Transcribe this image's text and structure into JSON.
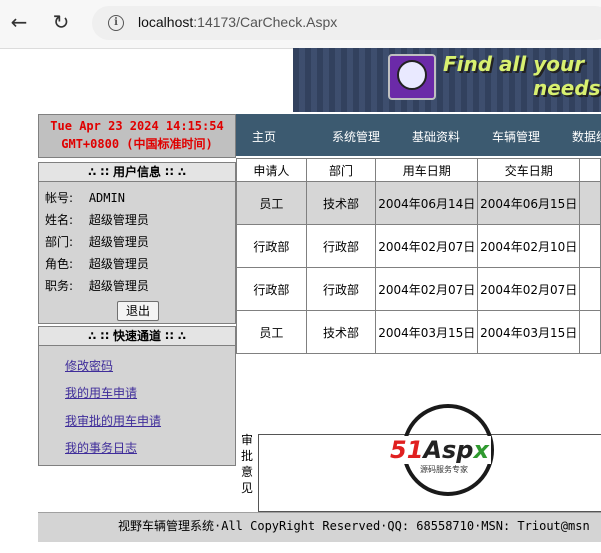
{
  "browser": {
    "back_icon": "arrow-left-icon",
    "reload_icon": "reload-icon",
    "url_host": "localhost",
    "url_path": ":14173/CarCheck.Aspx"
  },
  "banner": {
    "slogan_line1": "Find all your",
    "slogan_line2": "needs"
  },
  "clock": {
    "line1": "Tue Apr 23 2024 14:15:54",
    "line2": "GMT+0800 (中国标准时间)"
  },
  "nav": {
    "items": [
      "主页",
      "系统管理",
      "基础资料",
      "车辆管理",
      "数据统"
    ]
  },
  "user_info": {
    "title": "∴ ∷ 用户信息 ∷ ∴",
    "rows": [
      {
        "label": "帐号:",
        "value": "ADMIN"
      },
      {
        "label": "姓名:",
        "value": "超级管理员"
      },
      {
        "label": "部门:",
        "value": "超级管理员"
      },
      {
        "label": "角色:",
        "value": "超级管理员"
      },
      {
        "label": "职务:",
        "value": "超级管理员"
      }
    ],
    "logout_label": "退出"
  },
  "quick": {
    "title": "∴ ∷ 快速通道 ∷ ∴",
    "links": [
      "修改密码",
      "我的用车申请",
      "我审批的用车申请",
      "我的事务日志"
    ]
  },
  "table": {
    "headers": [
      "申请人",
      "部门",
      "用车日期",
      "交车日期"
    ],
    "rows": [
      [
        "员工",
        "技术部",
        "2004年06月14日",
        "2004年06月15日"
      ],
      [
        "行政部",
        "行政部",
        "2004年02月07日",
        "2004年02月10日"
      ],
      [
        "行政部",
        "行政部",
        "2004年02月07日",
        "2004年02月07日"
      ],
      [
        "员工",
        "技术部",
        "2004年03月15日",
        "2004年03月15日"
      ]
    ]
  },
  "logo": {
    "brand_51": "51",
    "brand_asp": "Asp",
    "brand_x": "x",
    "tagline": "源码服务专家"
  },
  "comment": {
    "label_chars": [
      "审",
      "批",
      "意",
      "见"
    ]
  },
  "footer": {
    "text": "视野车辆管理系统·All CopyRight Reserved·QQ: 68558710·MSN: Triout@msn"
  }
}
